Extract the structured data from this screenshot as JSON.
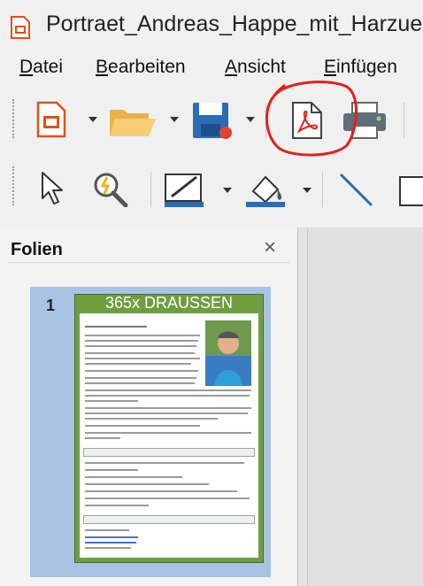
{
  "window": {
    "title": "Portraet_Andreas_Happe_mit_Harzue"
  },
  "menu": [
    {
      "mnemonic": "D",
      "rest": "atei"
    },
    {
      "mnemonic": "B",
      "rest": "earbeiten"
    },
    {
      "mnemonic": "A",
      "rest": "nsicht"
    },
    {
      "mnemonic": "E",
      "rest": "infügen"
    }
  ],
  "toolbar1": [
    "new-presentation-icon",
    "open-folder-icon",
    "save-icon",
    "export-pdf-icon",
    "print-icon"
  ],
  "toolbar2": [
    "select-arrow-icon",
    "zoom-icon",
    "line-color-icon",
    "fill-color-icon",
    "line-tool-icon",
    "rectangle-icon"
  ],
  "colors": {
    "annotation_circle": "#e41e1e",
    "slide_green": "#6e9e3e",
    "selection": "#a9c3e5"
  },
  "panel": {
    "title": "Folien",
    "close": "×"
  },
  "slides": [
    {
      "number": "1",
      "title": "365x DRAUSSEN"
    }
  ]
}
